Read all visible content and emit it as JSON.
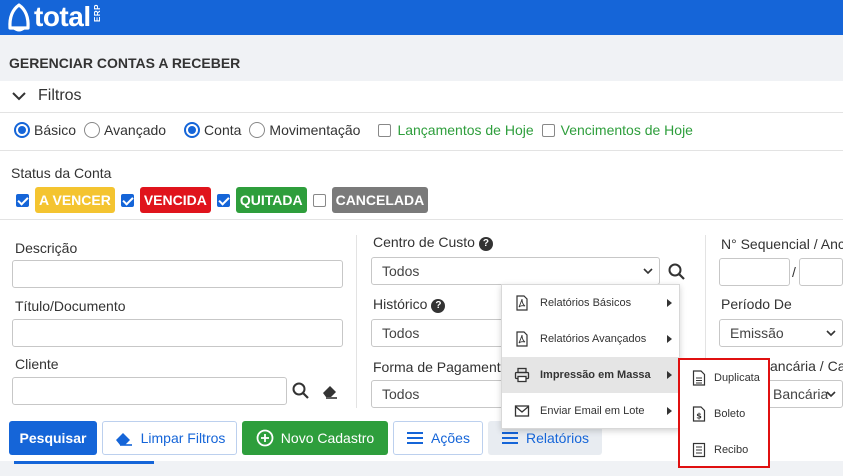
{
  "app": {
    "logo_text": "total",
    "logo_sup": "ERP"
  },
  "page": {
    "title": "GERENCIAR CONTAS A RECEBER"
  },
  "filters": {
    "label": "Filtros",
    "mode_options": [
      {
        "label": "Básico",
        "selected": true
      },
      {
        "label": "Avançado",
        "selected": false
      }
    ],
    "view_options": [
      {
        "label": "Conta",
        "selected": true
      },
      {
        "label": "Movimentação",
        "selected": false
      }
    ],
    "quick_checks": [
      {
        "label": "Lançamentos de Hoje",
        "checked": false
      },
      {
        "label": "Vencimentos de Hoje",
        "checked": false
      }
    ]
  },
  "status": {
    "label": "Status da Conta",
    "items": [
      {
        "label": "A VENCER",
        "checked": true,
        "color": "#f4c430"
      },
      {
        "label": "VENCIDA",
        "checked": true,
        "color": "#e0141c"
      },
      {
        "label": "QUITADA",
        "checked": true,
        "color": "#2e9e3c"
      },
      {
        "label": "CANCELADA",
        "checked": false,
        "color": "#7a7a7a"
      }
    ]
  },
  "fields": {
    "descricao": "Descrição",
    "titulo": "Título/Documento",
    "cliente": "Cliente",
    "centro_custo": {
      "label": "Centro de Custo",
      "value": "Todos"
    },
    "historico": {
      "label": "Histórico",
      "value": "Todos"
    },
    "forma_pagamento": {
      "label": "Forma de Pagament",
      "value": "Todos"
    },
    "sequencial": {
      "label": "N° Sequencial / Anc",
      "separator": "/"
    },
    "periodo": {
      "label": "Período De",
      "value": "Emissão"
    },
    "bancaria": {
      "label": "ancária / Ca",
      "value": "Bancária"
    }
  },
  "actions": {
    "pesquisar": "Pesquisar",
    "limpar": "Limpar Filtros",
    "novo": "Novo Cadastro",
    "acoes": "Ações",
    "relatorios": "Relatórios"
  },
  "reports_menu": {
    "items": [
      {
        "label": "Relatórios Básicos",
        "icon": "pdf-icon"
      },
      {
        "label": "Relatórios Avançados",
        "icon": "pdf-icon"
      },
      {
        "label": "Impressão em Massa",
        "icon": "printer-icon"
      },
      {
        "label": "Enviar Email em Lote",
        "icon": "envelope-icon"
      }
    ],
    "submenu": [
      {
        "label": "Duplicata",
        "icon": "document-icon"
      },
      {
        "label": "Boleto",
        "icon": "dollar-document-icon"
      },
      {
        "label": "Recibo",
        "icon": "receipt-icon"
      }
    ]
  },
  "colors": {
    "primary": "#1565d8",
    "success": "#2e9e3c",
    "highlight_border": "#e01010"
  }
}
